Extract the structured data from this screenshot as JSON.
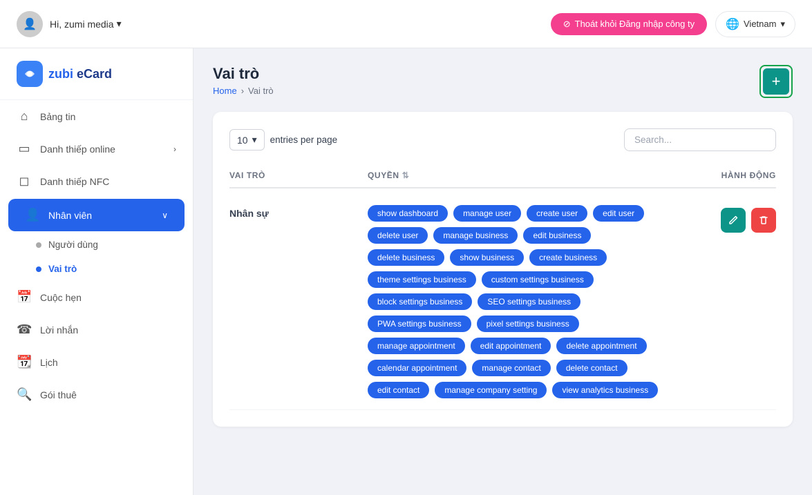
{
  "topbar": {
    "user_greeting": "Hi, zumi media",
    "user_chevron": "▾",
    "logout_label": "Thoát khỏi Đăng nhập công ty",
    "logout_icon": "⊘",
    "lang_label": "Vietnam",
    "lang_chevron": "▾"
  },
  "sidebar": {
    "logo_text1": "zubi",
    "logo_text2": " eCard",
    "nav_items": [
      {
        "id": "bang-tin",
        "label": "Bảng tin",
        "icon": "⌂",
        "active": false
      },
      {
        "id": "danh-thiep-online",
        "label": "Danh thiếp online",
        "icon": "▭",
        "active": false,
        "chevron": "›"
      },
      {
        "id": "danh-thiep-nfc",
        "label": "Danh thiếp NFC",
        "icon": "⊟",
        "active": false
      },
      {
        "id": "nhan-vien",
        "label": "Nhân viên",
        "icon": "👤",
        "active": true,
        "chevron": "∨"
      },
      {
        "id": "cuoc-hen",
        "label": "Cuộc hẹn",
        "icon": "📅",
        "active": false
      },
      {
        "id": "loi-nhan",
        "label": "Lời nhắn",
        "icon": "☎",
        "active": false
      },
      {
        "id": "lich",
        "label": "Lịch",
        "icon": "📆",
        "active": false
      },
      {
        "id": "goi-thue",
        "label": "Gói thuê",
        "icon": "🔍",
        "active": false
      }
    ],
    "sub_items": [
      {
        "id": "nguoi-dung",
        "label": "Người dùng",
        "active": false
      },
      {
        "id": "vai-tro",
        "label": "Vai trò",
        "active": true
      }
    ]
  },
  "page": {
    "title": "Vai trò",
    "breadcrumb_home": "Home",
    "breadcrumb_sep": "›",
    "breadcrumb_current": "Vai trò"
  },
  "table_controls": {
    "entries_per_page_value": "10",
    "entries_per_page_label": "entries per page",
    "search_placeholder": "Search..."
  },
  "table_headers": {
    "col1": "VAI TRÒ",
    "col2": "QUYỀN",
    "col3": "HÀNH ĐỘNG"
  },
  "rows": [
    {
      "label": "Nhân sự",
      "permissions": [
        "show dashboard",
        "manage user",
        "create user",
        "edit user",
        "delete user",
        "manage business",
        "edit business",
        "delete business",
        "show business",
        "create business",
        "theme settings business",
        "custom settings business",
        "block settings business",
        "SEO settings business",
        "PWA settings business",
        "pixel settings business",
        "manage appointment",
        "edit appointment",
        "delete appointment",
        "calendar appointment",
        "manage contact",
        "delete contact",
        "edit contact",
        "manage company setting",
        "view analytics business"
      ]
    }
  ],
  "add_button_label": "+"
}
